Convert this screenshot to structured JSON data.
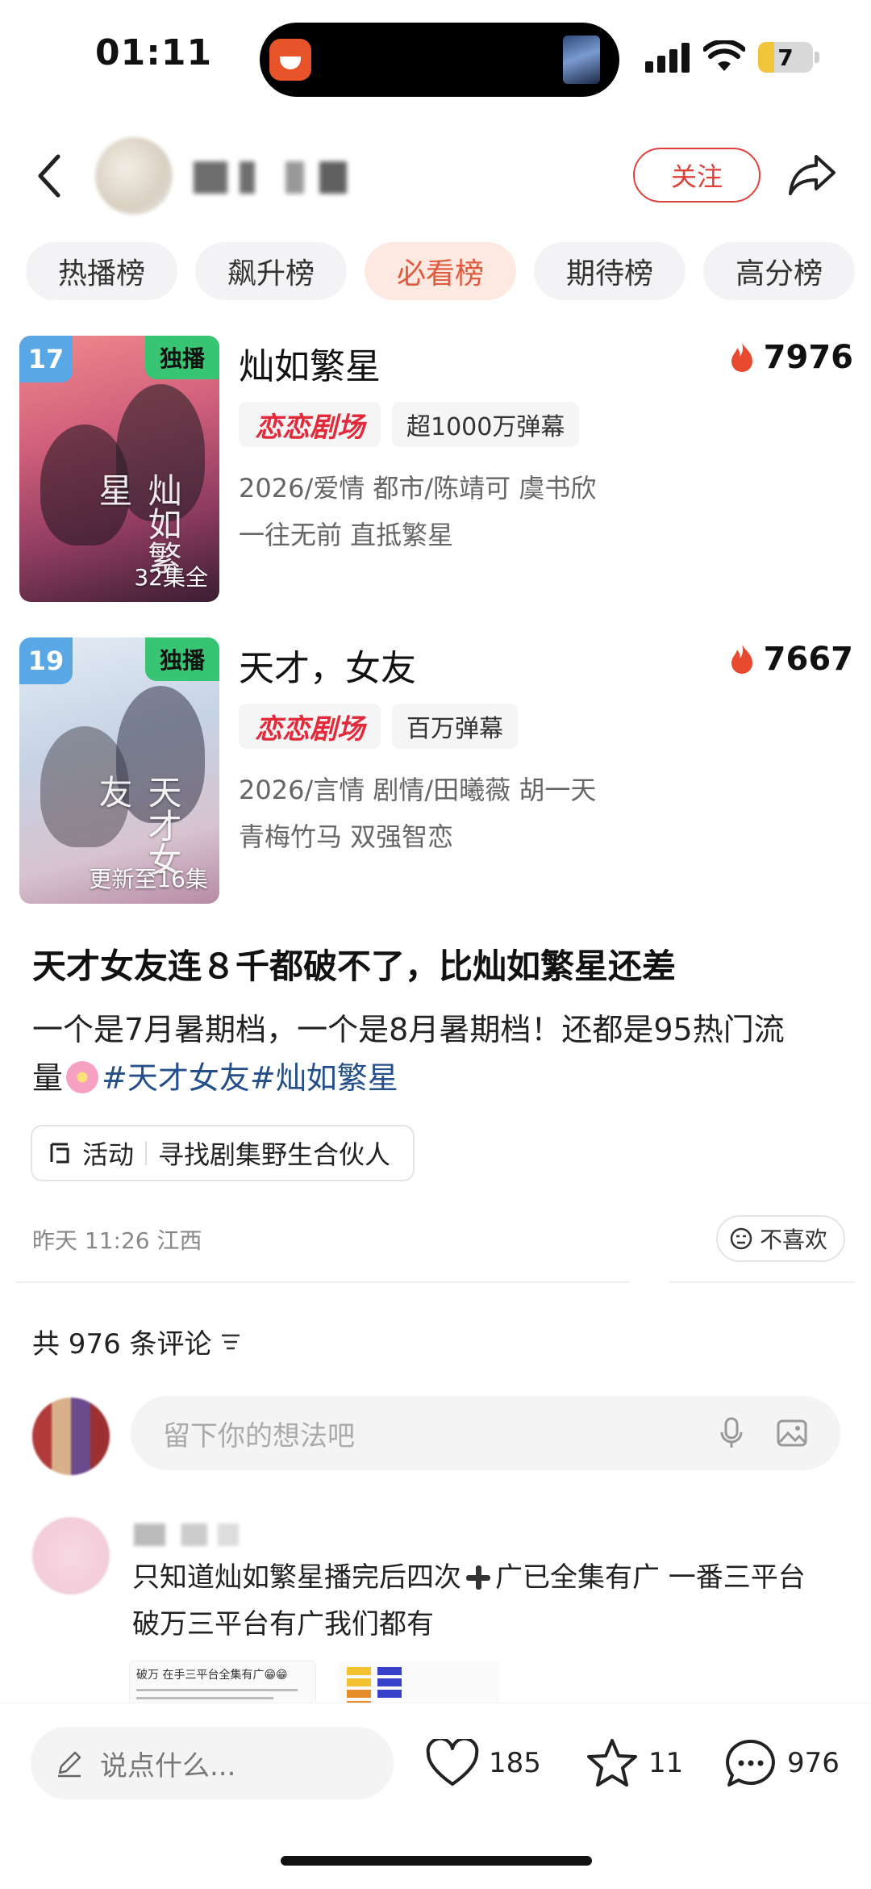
{
  "status_bar": {
    "time": "01:11",
    "battery": "7"
  },
  "header": {
    "follow_label": "关注"
  },
  "tabs": [
    {
      "label": "热播榜",
      "active": false
    },
    {
      "label": "飙升榜",
      "active": false
    },
    {
      "label": "必看榜",
      "active": true
    },
    {
      "label": "期待榜",
      "active": false
    },
    {
      "label": "高分榜",
      "active": false
    }
  ],
  "dramas": [
    {
      "rank": "17",
      "exclusive": "独播",
      "episodes": "32集全",
      "poster_text": "灿如繁星",
      "title": "灿如繁星",
      "heat": "7976",
      "platform": "恋恋剧场",
      "danmu": "超1000万弹幕",
      "meta": "2026/爱情 都市/陈靖可 虞书欣",
      "slogan": "一往无前 直抵繁星"
    },
    {
      "rank": "19",
      "exclusive": "独播",
      "episodes": "更新至16集",
      "poster_text": "天才女友",
      "title": "天才，女友",
      "heat": "7667",
      "platform": "恋恋剧场",
      "danmu": "百万弹幕",
      "meta": "2026/言情 剧情/田曦薇 胡一天",
      "slogan": "青梅竹马 双强智恋"
    }
  ],
  "post": {
    "title": "天才女友连８千都破不了，比灿如繁星还差",
    "body_line1": "一个是7月暑期档，一个是8月暑期档！还都是95热门流",
    "body_line2_prefix": "量",
    "tag1": "#天才女友",
    "tag2": "#灿如繁星",
    "activity_label": "活动",
    "activity_text": "寻找剧集野生合伙人",
    "time_location": "昨天 11:26 江西",
    "dislike_label": "不喜欢"
  },
  "comments": {
    "count_text": "共 976 条评论",
    "input_placeholder": "留下你的想法吧",
    "first": {
      "text_part1": "只知道灿如繁星播完后四次",
      "text_part2": "广已全集有广  一番三平台",
      "text_line2": "破万三平台有广我们都有",
      "image_caption": "破万 在手三平台全集有广😁😁"
    }
  },
  "bottom_bar": {
    "say_placeholder": "说点什么...",
    "likes": "185",
    "favorites": "11",
    "comments": "976"
  },
  "colors": {
    "accent": "#e0403a",
    "tag": "#244f8a",
    "active_tab_bg": "#fde8e2",
    "rank_badge": "#5aa7e6",
    "exclusive_badge": "#37c473"
  }
}
